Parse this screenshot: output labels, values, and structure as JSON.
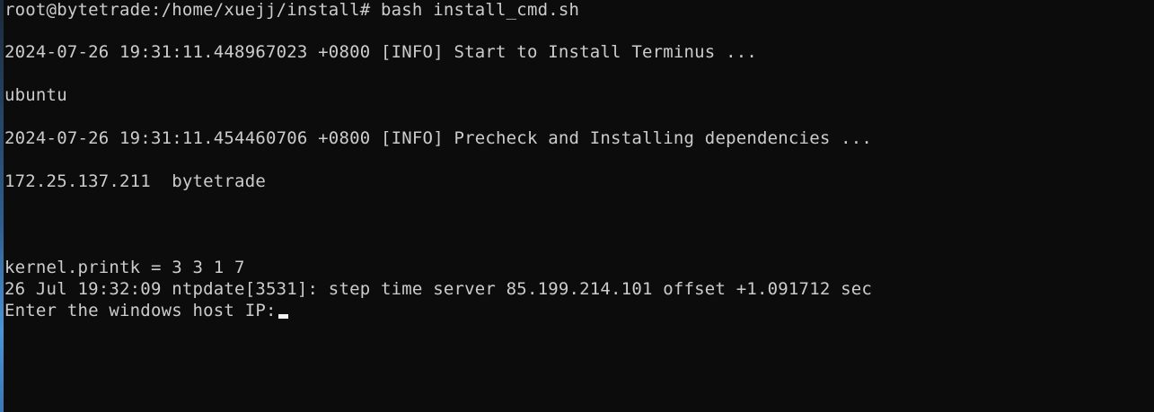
{
  "terminal": {
    "lines": [
      "root@bytetrade:/home/xuejj/install# bash install_cmd.sh",
      "2024-07-26 19:31:11.448967023 +0800 [INFO] Start to Install Terminus ...",
      "ubuntu",
      "2024-07-26 19:31:11.454460706 +0800 [INFO] Precheck and Installing dependencies ...",
      "172.25.137.211  bytetrade",
      "kernel.printk = 3 3 1 7",
      "26 Jul 19:32:09 ntpdate[3531]: step time server 85.199.214.101 offset +1.091712 sec"
    ],
    "prompt": "Enter the windows host IP:"
  },
  "colors": {
    "background": "#0c0c0c",
    "foreground": "#cccccc",
    "cursor": "#f2f2f2"
  }
}
